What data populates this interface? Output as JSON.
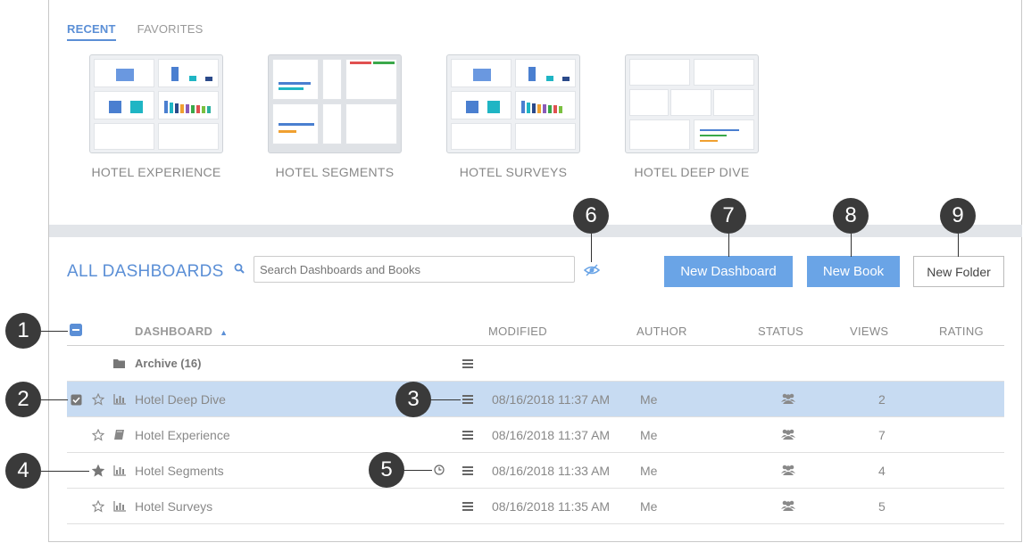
{
  "tabs": {
    "recent": "RECENT",
    "favorites": "FAVORITES"
  },
  "recent": [
    {
      "title": "HOTEL EXPERIENCE"
    },
    {
      "title": "HOTEL SEGMENTS"
    },
    {
      "title": "HOTEL SURVEYS"
    },
    {
      "title": "HOTEL DEEP DIVE"
    }
  ],
  "all_title": "ALL DASHBOARDS",
  "search": {
    "placeholder": "Search Dashboards and Books"
  },
  "buttons": {
    "new_dashboard": "New Dashboard",
    "new_book": "New Book",
    "new_folder": "New Folder"
  },
  "columns": {
    "dashboard": "DASHBOARD",
    "modified": "MODIFIED",
    "author": "AUTHOR",
    "status": "STATUS",
    "views": "VIEWS",
    "rating": "RATING"
  },
  "rows": [
    {
      "name": "Archive (16)"
    },
    {
      "name": "Hotel Deep Dive",
      "modified": "08/16/2018 11:37 AM",
      "author": "Me",
      "views": "2"
    },
    {
      "name": "Hotel Experience",
      "modified": "08/16/2018 11:37 AM",
      "author": "Me",
      "views": "7"
    },
    {
      "name": "Hotel Segments",
      "modified": "08/16/2018 11:33 AM",
      "author": "Me",
      "views": "4"
    },
    {
      "name": "Hotel Surveys",
      "modified": "08/16/2018 11:35 AM",
      "author": "Me",
      "views": "5"
    }
  ],
  "callouts": [
    "1",
    "2",
    "3",
    "4",
    "5",
    "6",
    "7",
    "8",
    "9"
  ],
  "colors": {
    "accent": "#5b8fd6",
    "button": "#6aa4e6",
    "selected_row": "#c7dbf2",
    "callout": "#3a3a3a"
  }
}
